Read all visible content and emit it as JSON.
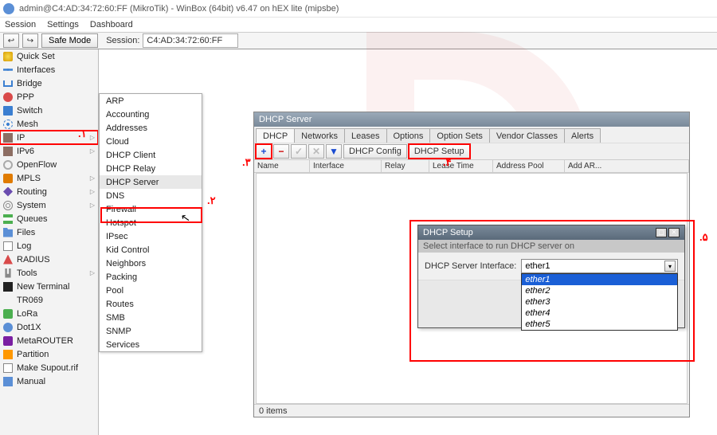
{
  "title": "admin@C4:AD:34:72:60:FF (MikroTik) - WinBox (64bit) v6.47 on hEX lite (mipsbe)",
  "menus": [
    "Session",
    "Settings",
    "Dashboard"
  ],
  "toolrow": {
    "back": "↩",
    "fwd": "↪",
    "safe_mode": "Safe Mode",
    "session_label": "Session:",
    "session_value": "C4:AD:34:72:60:FF"
  },
  "sidebar": [
    {
      "label": "Quick Set",
      "icon": "ic-quick"
    },
    {
      "label": "Interfaces",
      "icon": "ic-if"
    },
    {
      "label": "Bridge",
      "icon": "ic-bridge"
    },
    {
      "label": "PPP",
      "icon": "ic-ppp"
    },
    {
      "label": "Switch",
      "icon": "ic-switch"
    },
    {
      "label": "Mesh",
      "icon": "ic-mesh"
    },
    {
      "label": "IP",
      "icon": "ic-ip",
      "expand": true,
      "hl": true
    },
    {
      "label": "IPv6",
      "icon": "ic-ipv6",
      "expand": true
    },
    {
      "label": "OpenFlow",
      "icon": "ic-open"
    },
    {
      "label": "MPLS",
      "icon": "ic-mpls",
      "expand": true
    },
    {
      "label": "Routing",
      "icon": "ic-routing",
      "expand": true
    },
    {
      "label": "System",
      "icon": "ic-system",
      "expand": true
    },
    {
      "label": "Queues",
      "icon": "ic-queue"
    },
    {
      "label": "Files",
      "icon": "ic-files"
    },
    {
      "label": "Log",
      "icon": "ic-log"
    },
    {
      "label": "RADIUS",
      "icon": "ic-radius"
    },
    {
      "label": "Tools",
      "icon": "ic-tools",
      "expand": true
    },
    {
      "label": "New Terminal",
      "icon": "ic-term"
    },
    {
      "label": "TR069",
      "icon": ""
    },
    {
      "label": "LoRa",
      "icon": "ic-lora"
    },
    {
      "label": "Dot1X",
      "icon": "ic-dot1x"
    },
    {
      "label": "MetaROUTER",
      "icon": "ic-meta"
    },
    {
      "label": "Partition",
      "icon": "ic-part"
    },
    {
      "label": "Make Supout.rif",
      "icon": "ic-supout"
    },
    {
      "label": "Manual",
      "icon": "ic-manual"
    }
  ],
  "submenu": [
    "ARP",
    "Accounting",
    "Addresses",
    "Cloud",
    "DHCP Client",
    "DHCP Relay",
    "DHCP Server",
    "DNS",
    "Firewall",
    "Hotspot",
    "IPsec",
    "Kid Control",
    "Neighbors",
    "Packing",
    "Pool",
    "Routes",
    "SMB",
    "SNMP",
    "Services"
  ],
  "submenu_selected": 6,
  "dhcp_win": {
    "title": "DHCP Server",
    "tabs": [
      "DHCP",
      "Networks",
      "Leases",
      "Options",
      "Option Sets",
      "Vendor Classes",
      "Alerts"
    ],
    "active_tab": 0,
    "buttons": {
      "plus": "+",
      "minus": "−",
      "check": "✓",
      "x": "✕",
      "filter": "▼",
      "cfg": "DHCP Config",
      "setup": "DHCP Setup"
    },
    "cols": [
      "Name",
      "Interface",
      "Relay",
      "Lease Time",
      "Address Pool",
      "Add AR..."
    ],
    "status": "0 items"
  },
  "setup": {
    "title": "DHCP Setup",
    "sub": "Select interface to run DHCP server on",
    "label": "DHCP Server Interface:",
    "value": "ether1",
    "options": [
      "ether1",
      "ether2",
      "ether3",
      "ether4",
      "ether5"
    ],
    "selected": 0
  },
  "anno": {
    "1": ".۱",
    "2": ".۲",
    "3": ".۳",
    "4": ".۴",
    "5": ".۵"
  }
}
